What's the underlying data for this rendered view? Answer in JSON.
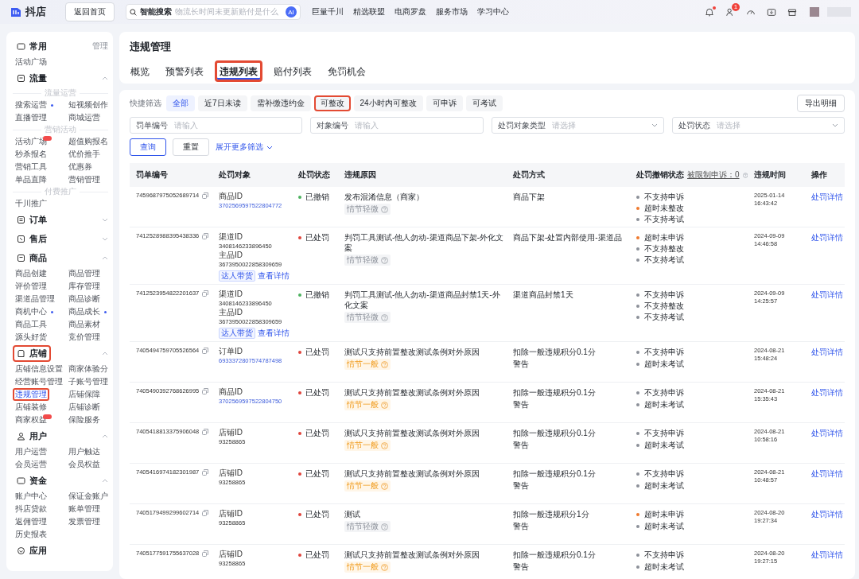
{
  "topbar": {
    "logo": "抖店",
    "home_button": "返回首页",
    "search": {
      "label": "智能搜索",
      "placeholder": "物流长时间未更新赔付是什么"
    },
    "ai_badge": "AI",
    "nav": [
      "巨量千川",
      "精选联盟",
      "电商罗盘",
      "服务市场",
      "学习中心"
    ],
    "icons": [
      {
        "dot": true
      },
      {
        "dot": false,
        "badge": "1"
      },
      {
        "dot": false
      },
      {
        "dot": false
      },
      {
        "dot": false
      }
    ]
  },
  "sidebar": {
    "sections": [
      {
        "title": "常用",
        "action": "管理",
        "marked": false,
        "groups": [
          {
            "items": [
              {
                "label": "活动广场",
                "selected": false,
                "marked": false,
                "dot": false,
                "badge": false
              }
            ]
          }
        ]
      },
      {
        "title": "流量",
        "expanded": true,
        "marked": false,
        "groups": [
          {
            "heading": "流量运营",
            "items": [
              {
                "label": "搜索运营",
                "selected": false,
                "marked": false,
                "dot": true,
                "badge": false
              },
              {
                "label": "短视频创作",
                "selected": false,
                "marked": false,
                "dot": false,
                "badge": false
              },
              {
                "label": "直播管理",
                "selected": false,
                "marked": false,
                "dot": false,
                "badge": false
              },
              {
                "label": "商城运营",
                "selected": false,
                "marked": false,
                "dot": false,
                "badge": false
              }
            ]
          },
          {
            "heading": "营销活动",
            "items": [
              {
                "label": "活动广场",
                "selected": false,
                "marked": false,
                "dot": false,
                "badge": true
              },
              {
                "label": "超值购报名",
                "selected": false,
                "marked": false,
                "dot": false,
                "badge": false
              },
              {
                "label": "秒杀报名",
                "selected": false,
                "marked": false,
                "dot": false,
                "badge": false
              },
              {
                "label": "优价推手",
                "selected": false,
                "marked": false,
                "dot": false,
                "badge": false
              },
              {
                "label": "营销工具",
                "selected": false,
                "marked": false,
                "dot": false,
                "badge": false
              },
              {
                "label": "优惠券",
                "selected": false,
                "marked": false,
                "dot": false,
                "badge": false
              },
              {
                "label": "单品直降",
                "selected": false,
                "marked": false,
                "dot": false,
                "badge": false
              },
              {
                "label": "营销管理",
                "selected": false,
                "marked": false,
                "dot": false,
                "badge": false
              }
            ]
          },
          {
            "heading": "付费推广",
            "items": [
              {
                "label": "千川推广",
                "selected": false,
                "marked": false,
                "dot": false,
                "badge": false
              }
            ]
          }
        ]
      },
      {
        "title": "订单",
        "expanded": false,
        "marked": false
      },
      {
        "title": "售后",
        "expanded": false,
        "marked": false
      },
      {
        "title": "商品",
        "expanded": true,
        "marked": false,
        "groups": [
          {
            "items": [
              {
                "label": "商品创建",
                "selected": false,
                "marked": false,
                "dot": false,
                "badge": false
              },
              {
                "label": "商品管理",
                "selected": false,
                "marked": false,
                "dot": false,
                "badge": false
              },
              {
                "label": "评价管理",
                "selected": false,
                "marked": false,
                "dot": false,
                "badge": false
              },
              {
                "label": "库存管理",
                "selected": false,
                "marked": false,
                "dot": false,
                "badge": false
              },
              {
                "label": "渠道品管理",
                "selected": false,
                "marked": false,
                "dot": false,
                "badge": false
              },
              {
                "label": "商品诊断",
                "selected": false,
                "marked": false,
                "dot": false,
                "badge": false
              },
              {
                "label": "商机中心",
                "selected": false,
                "marked": false,
                "dot": true,
                "badge": false
              },
              {
                "label": "商品成长",
                "selected": false,
                "marked": false,
                "dot": true,
                "badge": false
              },
              {
                "label": "商品工具",
                "selected": false,
                "marked": false,
                "dot": false,
                "badge": false
              },
              {
                "label": "商品素材",
                "selected": false,
                "marked": false,
                "dot": false,
                "badge": false
              },
              {
                "label": "源头好货",
                "selected": false,
                "marked": false,
                "dot": false,
                "badge": false
              },
              {
                "label": "竞价管理",
                "selected": false,
                "marked": false,
                "dot": false,
                "badge": false
              }
            ]
          }
        ]
      },
      {
        "title": "店铺",
        "expanded": true,
        "marked": true,
        "groups": [
          {
            "items": [
              {
                "label": "店铺信息设置",
                "selected": false,
                "marked": false,
                "dot": false,
                "badge": false
              },
              {
                "label": "商家体验分",
                "selected": false,
                "marked": false,
                "dot": false,
                "badge": false
              },
              {
                "label": "经营账号管理",
                "selected": false,
                "marked": false,
                "dot": false,
                "badge": false
              },
              {
                "label": "子账号管理",
                "selected": false,
                "marked": false,
                "dot": false,
                "badge": false
              },
              {
                "label": "违规管理",
                "selected": true,
                "marked": true,
                "dot": false,
                "badge": false
              },
              {
                "label": "店铺保障",
                "selected": false,
                "marked": false,
                "dot": false,
                "badge": false
              },
              {
                "label": "店铺装修",
                "selected": false,
                "marked": false,
                "dot": false,
                "badge": false
              },
              {
                "label": "店铺诊断",
                "selected": false,
                "marked": false,
                "dot": false,
                "badge": false
              },
              {
                "label": "商家权益",
                "selected": false,
                "marked": false,
                "dot": false,
                "badge": true
              },
              {
                "label": "保险服务",
                "selected": false,
                "marked": false,
                "dot": false,
                "badge": false
              }
            ]
          }
        ]
      },
      {
        "title": "用户",
        "expanded": true,
        "marked": false,
        "groups": [
          {
            "items": [
              {
                "label": "用户运营",
                "selected": false,
                "marked": false,
                "dot": false,
                "badge": false
              },
              {
                "label": "用户触达",
                "selected": false,
                "marked": false,
                "dot": false,
                "badge": false
              },
              {
                "label": "会员运营",
                "selected": false,
                "marked": false,
                "dot": false,
                "badge": false
              },
              {
                "label": "会员权益",
                "selected": false,
                "marked": false,
                "dot": false,
                "badge": false
              }
            ]
          }
        ]
      },
      {
        "title": "资金",
        "expanded": true,
        "marked": false,
        "groups": [
          {
            "items": [
              {
                "label": "账户中心",
                "selected": false,
                "marked": false,
                "dot": false,
                "badge": false
              },
              {
                "label": "保证金账户",
                "selected": false,
                "marked": false,
                "dot": false,
                "badge": false
              },
              {
                "label": "抖店贷款",
                "selected": false,
                "marked": false,
                "dot": false,
                "badge": false
              },
              {
                "label": "账单管理",
                "selected": false,
                "marked": false,
                "dot": false,
                "badge": false
              },
              {
                "label": "返佣管理",
                "selected": false,
                "marked": false,
                "dot": false,
                "badge": false
              },
              {
                "label": "发票管理",
                "selected": false,
                "marked": false,
                "dot": false,
                "badge": false
              },
              {
                "label": "历史报表",
                "selected": false,
                "marked": false,
                "dot": false,
                "badge": false
              }
            ]
          }
        ]
      },
      {
        "title": "应用",
        "marked": false
      }
    ]
  },
  "header": {
    "title": "违规管理",
    "tabs": [
      {
        "label": "概览",
        "selected": false,
        "marked": false
      },
      {
        "label": "预警列表",
        "selected": false,
        "marked": false
      },
      {
        "label": "违规列表",
        "selected": true,
        "marked": true
      },
      {
        "label": "赔付列表",
        "selected": false,
        "marked": false
      },
      {
        "label": "免罚机会",
        "selected": false,
        "marked": false
      }
    ]
  },
  "filters": {
    "quick_label": "快捷筛选",
    "chips": [
      {
        "label": "全部",
        "selected": true,
        "marked": false
      },
      {
        "label": "近7日未读",
        "selected": false,
        "marked": false
      },
      {
        "label": "需补缴违约金",
        "selected": false,
        "marked": false
      },
      {
        "label": "可整改",
        "selected": false,
        "marked": true
      },
      {
        "label": "24小时内可整改",
        "selected": false,
        "marked": false
      },
      {
        "label": "可申诉",
        "selected": false,
        "marked": false
      },
      {
        "label": "可考试",
        "selected": false,
        "marked": false
      }
    ],
    "export_button": "导出明细",
    "fields": [
      {
        "label": "罚单编号",
        "placeholder": "请输入",
        "kind": "text"
      },
      {
        "label": "对象编号",
        "placeholder": "请输入",
        "kind": "text"
      },
      {
        "label": "处罚对象类型",
        "placeholder": "请选择",
        "kind": "select"
      },
      {
        "label": "处罚状态",
        "placeholder": "请选择",
        "kind": "select"
      }
    ],
    "query_button": "查询",
    "reset_button": "重置",
    "expand_link": "展开更多筛选"
  },
  "table": {
    "columns": [
      {
        "label": "罚单编号"
      },
      {
        "label": "处罚对象"
      },
      {
        "label": "处罚状态"
      },
      {
        "label": "违规原因"
      },
      {
        "label": "处罚方式"
      },
      {
        "label": "处罚撤销状态",
        "extra": "被限制申诉：0"
      },
      {
        "label": "违规时间"
      },
      {
        "label": "操作"
      }
    ],
    "rows": [
      {
        "id": "7459687975052689714",
        "targets": [
          {
            "label": "商品ID",
            "value": "3702569597522804772",
            "link": true
          }
        ],
        "status": {
          "text": "已撤销",
          "color": "#4cb25f"
        },
        "reason": "发布混淆信息（商家）",
        "severity": {
          "text": "情节轻微",
          "kind": "minor"
        },
        "methods": [
          "商品下架"
        ],
        "revocation": [
          {
            "text": "不支持申诉",
            "color": "#8c9099"
          },
          {
            "text": "超时未整改",
            "color": "#f07a2f"
          },
          {
            "text": "不支持考试",
            "color": "#8c9099"
          }
        ],
        "date": "2025-01-14",
        "time": "16:43:42",
        "action": "处罚详情"
      },
      {
        "id": "7412528988395438336",
        "targets": [
          {
            "label": "渠道ID",
            "value": "3408146233896450",
            "link": false
          },
          {
            "label": "主品ID",
            "value": "3673950022858309659",
            "link": false
          }
        ],
        "tags": [
          "达人带货"
        ],
        "detail_link": "查看详情",
        "status": {
          "text": "已处罚",
          "color": "#e0443c"
        },
        "reason": "判罚工具测试-他人勿动-渠道商品下架-外化文案",
        "severity": {
          "text": "情节轻微",
          "kind": "minor"
        },
        "methods": [
          "商品下架-处置内部使用-渠道品"
        ],
        "revocation": [
          {
            "text": "超时未申诉",
            "color": "#f07a2f"
          },
          {
            "text": "不支持整改",
            "color": "#8c9099"
          },
          {
            "text": "不支持考试",
            "color": "#8c9099"
          }
        ],
        "date": "2024-09-09",
        "time": "14:46:58",
        "action": "处罚详情"
      },
      {
        "id": "7412523954822201637",
        "targets": [
          {
            "label": "渠道ID",
            "value": "3408146233896450",
            "link": false
          },
          {
            "label": "主品ID",
            "value": "3673950022858309659",
            "link": false
          }
        ],
        "tags": [
          "达人带货"
        ],
        "detail_link": "查看详情",
        "status": {
          "text": "已撤销",
          "color": "#4cb25f"
        },
        "reason": "判罚工具测试-他人勿动-渠道商品封禁1天-外化文案",
        "severity": {
          "text": "情节轻微",
          "kind": "minor"
        },
        "methods": [
          "渠道商品封禁1天"
        ],
        "revocation": [
          {
            "text": "不支持申诉",
            "color": "#8c9099"
          },
          {
            "text": "不支持整改",
            "color": "#8c9099"
          },
          {
            "text": "不支持考试",
            "color": "#8c9099"
          }
        ],
        "date": "2024-09-09",
        "time": "14:25:57",
        "action": "处罚详情"
      },
      {
        "id": "7405494759705526564",
        "targets": [
          {
            "label": "订单ID",
            "value": "6933372807574787498",
            "link": true
          }
        ],
        "status": {
          "text": "已处罚",
          "color": "#e0443c"
        },
        "reason": "测试只支持前置整改测试条例对外原因",
        "severity": {
          "text": "情节一般",
          "kind": "general"
        },
        "methods": [
          "扣除一般违规积分0.1分",
          "警告"
        ],
        "revocation": [
          {
            "text": "不支持申诉",
            "color": "#8c9099"
          },
          {
            "text": "超时未考试",
            "color": "#8c9099"
          }
        ],
        "date": "2024-08-21",
        "time": "15:48:24",
        "action": "处罚详情"
      },
      {
        "id": "7405490392768626995",
        "targets": [
          {
            "label": "商品ID",
            "value": "3702569597522804750",
            "link": true
          }
        ],
        "status": {
          "text": "已处罚",
          "color": "#e0443c"
        },
        "reason": "测试只支持前置整改测试条例对外原因",
        "severity": {
          "text": "情节一般",
          "kind": "general"
        },
        "methods": [
          "扣除一般违规积分0.1分",
          "警告"
        ],
        "revocation": [
          {
            "text": "不支持申诉",
            "color": "#8c9099"
          },
          {
            "text": "超时未考试",
            "color": "#8c9099"
          }
        ],
        "date": "2024-08-21",
        "time": "15:35:43",
        "action": "处罚详情"
      },
      {
        "id": "7405418813375906048",
        "targets": [
          {
            "label": "店铺ID",
            "value": "93258865",
            "link": false
          }
        ],
        "status": {
          "text": "已处罚",
          "color": "#e0443c"
        },
        "reason": "测试只支持前置整改测试条例对外原因",
        "severity": {
          "text": "情节一般",
          "kind": "general"
        },
        "methods": [
          "扣除一般违规积分0.1分",
          "警告"
        ],
        "revocation": [
          {
            "text": "不支持申诉",
            "color": "#8c9099"
          },
          {
            "text": "超时未考试",
            "color": "#8c9099"
          }
        ],
        "date": "2024-08-21",
        "time": "10:58:16",
        "action": "处罚详情"
      },
      {
        "id": "7405416974182301987",
        "targets": [
          {
            "label": "店铺ID",
            "value": "93258865",
            "link": false
          }
        ],
        "status": {
          "text": "已处罚",
          "color": "#e0443c"
        },
        "reason": "测试只支持前置整改测试条例对外原因",
        "severity": {
          "text": "情节一般",
          "kind": "general"
        },
        "methods": [
          "扣除一般违规积分0.1分",
          "警告"
        ],
        "revocation": [
          {
            "text": "不支持申诉",
            "color": "#8c9099"
          },
          {
            "text": "超时未考试",
            "color": "#8c9099"
          }
        ],
        "date": "2024-08-21",
        "time": "10:48:57",
        "action": "处罚详情"
      },
      {
        "id": "7405179499299602714",
        "targets": [
          {
            "label": "店铺ID",
            "value": "93258865",
            "link": false
          }
        ],
        "status": {
          "text": "已处罚",
          "color": "#e0443c"
        },
        "reason": "测试",
        "severity": {
          "text": "情节轻微",
          "kind": "minor"
        },
        "methods": [
          "扣除一般违规积分1分",
          "警告"
        ],
        "revocation": [
          {
            "text": "超时未申诉",
            "color": "#f07a2f"
          },
          {
            "text": "超时未考试",
            "color": "#8c9099"
          }
        ],
        "date": "2024-08-20",
        "time": "19:27:34",
        "action": "处罚详情"
      },
      {
        "id": "7405177591755637028",
        "targets": [
          {
            "label": "店铺ID",
            "value": "93258865",
            "link": false
          }
        ],
        "status": {
          "text": "已处罚",
          "color": "#e0443c"
        },
        "reason": "测试只支持前置整改测试条例对外原因",
        "severity": {
          "text": "情节一般",
          "kind": "general"
        },
        "methods": [
          "扣除一般违规积分0.1分",
          "警告"
        ],
        "revocation": [
          {
            "text": "不支持申诉",
            "color": "#8c9099"
          },
          {
            "text": "超时未考试",
            "color": "#8c9099"
          }
        ],
        "date": "2024-08-20",
        "time": "19:27:15",
        "action": "处罚详情"
      }
    ]
  }
}
